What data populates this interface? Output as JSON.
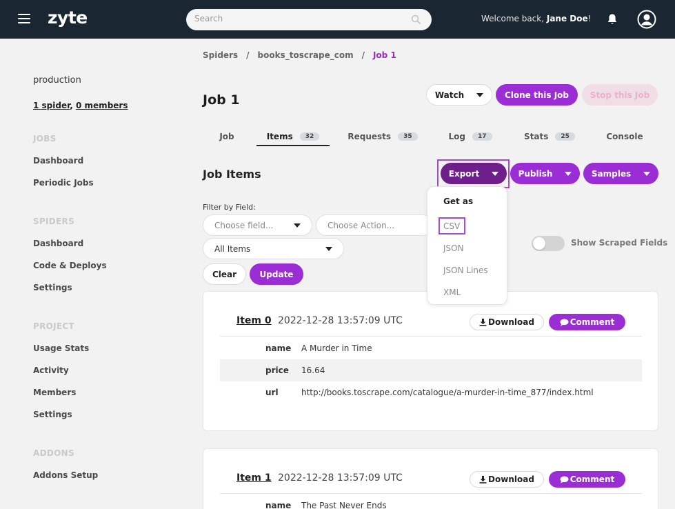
{
  "header": {
    "logo": "zyte",
    "search_placeholder": "Search",
    "welcome_prefix": "Welcome back, ",
    "user_name": "Jane Doe",
    "welcome_suffix": "!"
  },
  "sidebar": {
    "org": "production",
    "spider_link": "1 spider",
    "sep": ", ",
    "members_link": "0 members",
    "sections": [
      {
        "heading": "JOBS",
        "items": [
          "Dashboard",
          "Periodic Jobs"
        ]
      },
      {
        "heading": "SPIDERS",
        "items": [
          "Dashboard",
          "Code & Deploys",
          "Settings"
        ]
      },
      {
        "heading": "PROJECT",
        "items": [
          "Usage Stats",
          "Activity",
          "Members",
          "Settings"
        ]
      },
      {
        "heading": "ADDONS",
        "items": [
          "Addons Setup"
        ]
      }
    ]
  },
  "breadcrumb": [
    "Spiders",
    "books_toscrape_com",
    "Job 1"
  ],
  "breadcrumb_sep": "/",
  "page": {
    "title": "Job 1",
    "watch_label": "Watch",
    "clone_label": "Clone this Job",
    "stop_label": "Stop this Job"
  },
  "tabs": [
    {
      "label": "Job",
      "count": ""
    },
    {
      "label": "Items",
      "count": "32"
    },
    {
      "label": "Requests",
      "count": "35"
    },
    {
      "label": "Log",
      "count": "17"
    },
    {
      "label": "Stats",
      "count": "25"
    },
    {
      "label": "Console",
      "count": ""
    }
  ],
  "items_section": {
    "title": "Job Items",
    "export_label": "Export",
    "publish_label": "Publish",
    "samples_label": "Samples",
    "filter_label": "Filter by Field:",
    "field_placeholder": "Choose field...",
    "action_placeholder": "Choose Action...",
    "scope_value": "All Items",
    "clear_label": "Clear",
    "update_label": "Update",
    "toggle_label": "Show Scraped Fields",
    "toggle_on": false
  },
  "export_menu": {
    "heading": "Get as",
    "options": [
      "CSV",
      "JSON",
      "JSON Lines",
      "XML"
    ]
  },
  "items": [
    {
      "title": "Item 0",
      "date": "2022-12-28 13:57:09 UTC",
      "download_label": "Download",
      "comment_label": "Comment",
      "fields": [
        {
          "key": "name",
          "value": "A Murder in Time"
        },
        {
          "key": "price",
          "value": "16.64"
        },
        {
          "key": "url",
          "value": "http://books.toscrape.com/catalogue/a-murder-in-time_877/index.html"
        }
      ]
    },
    {
      "title": "Item 1",
      "date": "2022-12-28 13:57:09 UTC",
      "download_label": "Download",
      "comment_label": "Comment",
      "fields": [
        {
          "key": "name",
          "value": "The Past Never Ends"
        }
      ]
    }
  ],
  "colors": {
    "topbar": "#1b2633",
    "accent": "#9a2dd4",
    "export_active": "#6e1f8c",
    "highlight_frame": "#a24ad0"
  }
}
